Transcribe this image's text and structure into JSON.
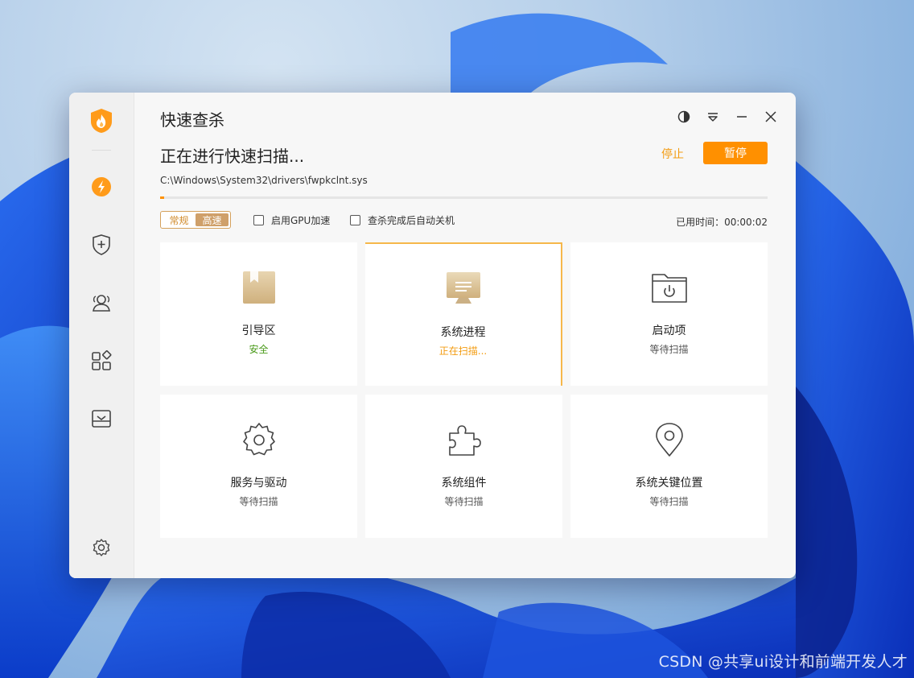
{
  "window": {
    "title": "快速查杀",
    "scan_heading": "正在进行快速扫描...",
    "stop_label": "停止",
    "pause_label": "暂停",
    "current_path": "C:\\Windows\\System32\\drivers\\fwpkclnt.sys",
    "progress": 0.006
  },
  "options": {
    "mode_normal": "常规",
    "mode_fast": "高速",
    "active_mode": "高速",
    "gpu_label": "启用GPU加速",
    "gpu_checked": false,
    "shutdown_label": "查杀完成后自动关机",
    "shutdown_checked": false,
    "elapsed": "已用时间：00:00:02"
  },
  "cards": [
    {
      "title": "引导区",
      "status": "安全",
      "status_color": "#4a9a1a",
      "icon": "bookmark-box-icon"
    },
    {
      "title": "系统进程",
      "status": "正在扫描...",
      "status_color": "#f39c12",
      "icon": "monitor-icon"
    },
    {
      "title": "启动项",
      "status": "等待扫描",
      "status_color": "#555555",
      "icon": "folder-power-icon"
    },
    {
      "title": "服务与驱动",
      "status": "等待扫描",
      "status_color": "#555555",
      "icon": "gear-icon"
    },
    {
      "title": "系统组件",
      "status": "等待扫描",
      "status_color": "#555555",
      "icon": "puzzle-icon"
    },
    {
      "title": "系统关键位置",
      "status": "等待扫描",
      "status_color": "#555555",
      "icon": "location-pin-icon"
    }
  ],
  "colors": {
    "accent": "#ff9000",
    "active_border": "#f6b74a",
    "safe": "#4a9a1a"
  },
  "watermark": "CSDN @共享ui设计和前端开发人才"
}
